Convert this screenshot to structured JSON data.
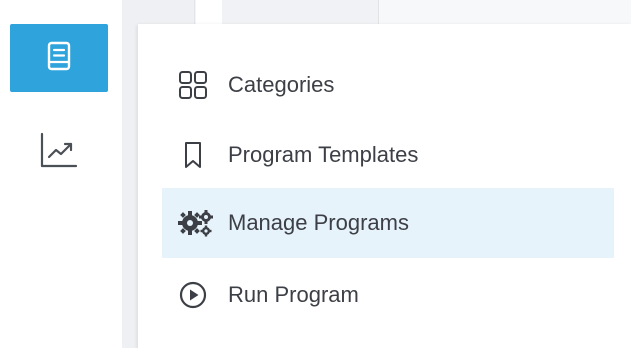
{
  "nav_rail": {
    "items": [
      {
        "icon": "book-icon",
        "active": true
      },
      {
        "icon": "trend-chart-icon",
        "active": false
      }
    ],
    "active_color": "#2ea3dc"
  },
  "menu": {
    "items": [
      {
        "label": "Categories",
        "icon": "grid-icon"
      },
      {
        "label": "Program Templates",
        "icon": "bookmark-icon"
      },
      {
        "label": "Manage Programs",
        "icon": "gears-icon",
        "selected": true
      },
      {
        "label": "Run Program",
        "icon": "play-circle-icon"
      }
    ],
    "selected_color": "#e7f3fb"
  }
}
